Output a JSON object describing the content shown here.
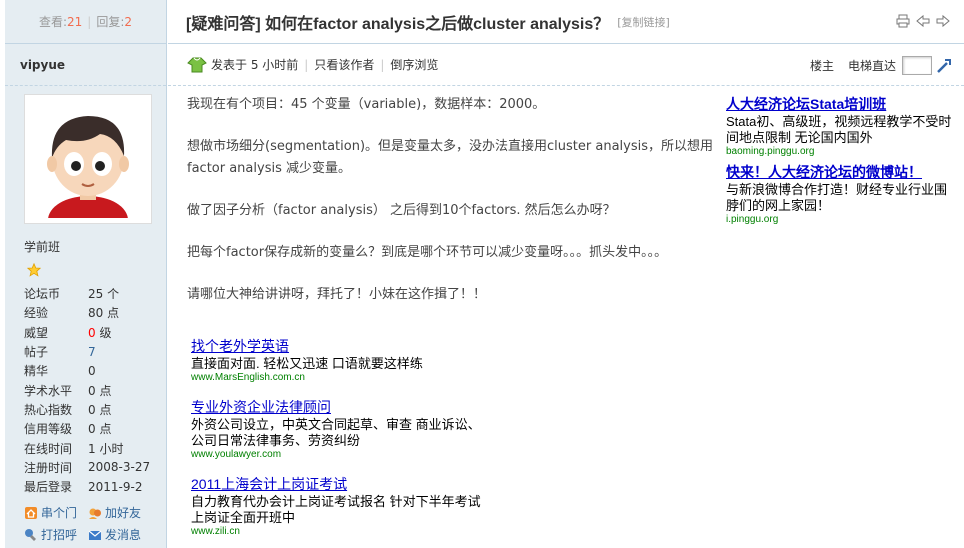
{
  "stats": {
    "views_label": "查看:",
    "views_value": "21",
    "replies_label": "回复:",
    "replies_value": "2"
  },
  "author": {
    "username": "vipyue",
    "group": "学前班",
    "profile": [
      {
        "key": "论坛币",
        "value": "25 个"
      },
      {
        "key": "经验",
        "value": "80 点"
      },
      {
        "key": "威望",
        "value_red": "0",
        "value": " 级"
      },
      {
        "key": "帖子",
        "value": "7"
      },
      {
        "key": "精华",
        "value": "0"
      },
      {
        "key": "学术水平",
        "value": "0 点"
      },
      {
        "key": "热心指数",
        "value": "0 点"
      },
      {
        "key": "信用等级",
        "value": "0 点"
      },
      {
        "key": "在线时间",
        "value": "1 小时"
      },
      {
        "key": "注册时间",
        "value": "2008-3-27"
      },
      {
        "key": "最后登录",
        "value": "2011-9-2"
      }
    ],
    "actions": [
      "串个门",
      "加好友",
      "打招呼",
      "发消息"
    ]
  },
  "thread": {
    "title": "[疑难问答] 如何在factor analysis之后做cluster analysis？",
    "copy_link": "[复制链接]"
  },
  "meta": {
    "posted": "发表于 5 小时前",
    "only_author": "只看该作者",
    "reverse": "倒序浏览",
    "floor": "楼主",
    "jump": "电梯直达"
  },
  "post": {
    "paragraphs": [
      "我现在有个项目：45 个变量（variable)，数据样本：2000。",
      "想做市场细分(segmentation)。但是变量太多，没办法直接用cluster analysis，所以想用factor analysis 减少变量。",
      "做了因子分析（factor analysis） 之后得到10个factors. 然后怎么办呀？",
      "把每个factor保存成新的变量么？到底是哪个环节可以减少变量呀。。。抓头发中。。。",
      "请哪位大神给讲讲呀，拜托了！小妹在这作揖了！！"
    ]
  },
  "ads_right": [
    {
      "title": "人大经济论坛Stata培训班",
      "desc": "Stata初、高级班，视频远程教学不受时间地点限制 无论国内国外",
      "url": "baoming.pinggu.org"
    },
    {
      "title": "快来！人大经济论坛的微博站！",
      "desc": "与新浪微博合作打造！财经专业行业围脖们的网上家园！",
      "url": "i.pinggu.org"
    }
  ],
  "ads_bottom": [
    {
      "title": "找个老外学英语",
      "desc": "直接面对面. 轻松又迅速 口语就要这样练",
      "url": "www.MarsEnglish.com.cn"
    },
    {
      "title": "专业外资企业法律顾问",
      "desc": "外资公司设立，中英文合同起草、审查 商业诉讼、公司日常法律事务、劳资纠纷",
      "url": "www.youlawyer.com"
    },
    {
      "title": "2011上海会计上岗证考试",
      "desc": "自力教育代办会计上岗证考试报名 针对下半年考试上岗证全面开班中",
      "url": "www.zili.cn"
    }
  ],
  "colors": {
    "sidebar_bg": "#e5edf2",
    "border": "#c2d5e3",
    "ad_link": "#0000cc",
    "ad_url": "#008000",
    "count_accent": "#f26c4f"
  },
  "icons": [
    "printer-icon",
    "prev-thread-icon",
    "next-thread-icon",
    "online-user-icon",
    "jump-go-icon",
    "home-icon",
    "add-friend-icon",
    "greet-icon",
    "message-icon",
    "star-icon"
  ]
}
